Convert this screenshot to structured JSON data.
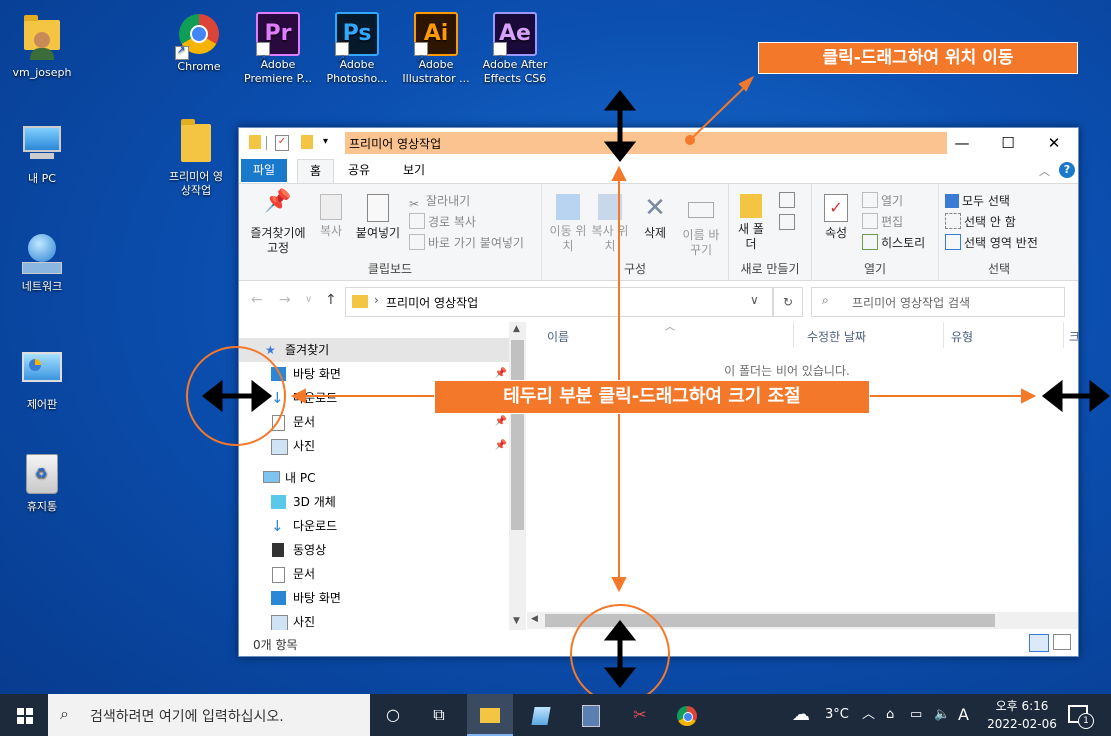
{
  "desktop": {
    "icons": [
      {
        "label": "vm_joseph"
      },
      {
        "label": "Chrome"
      },
      {
        "label": "Adobe Premiere P...",
        "abbr": "Pr"
      },
      {
        "label": "Adobe Photosho...",
        "abbr": "Ps"
      },
      {
        "label": "Adobe Illustrator ...",
        "abbr": "Ai"
      },
      {
        "label": "Adobe After Effects CS6",
        "abbr": "Ae"
      },
      {
        "label": "내 PC"
      },
      {
        "label": "프리미어 영상작업"
      },
      {
        "label": "네트워크"
      },
      {
        "label": "제어판"
      },
      {
        "label": "휴지통"
      }
    ]
  },
  "annotations": {
    "move": "클릭-드래그하여 위치 이동",
    "resize": "테두리 부분 클릭-드래그하여 크기 조절",
    "accent": "#f4782a"
  },
  "explorer": {
    "title": "프리미어 영상작업",
    "tabs": [
      "파일",
      "홈",
      "공유",
      "보기"
    ],
    "ribbon": {
      "clipboard": {
        "label": "클립보드",
        "pin": "즐겨찾기에 고정",
        "copy": "복사",
        "paste": "붙여넣기",
        "cut": "잘라내기",
        "copy_path": "경로 복사",
        "paste_shortcut": "바로 가기 붙여넣기"
      },
      "organize": {
        "label": "구성",
        "move_to": "이동 위치",
        "copy_to": "복사 위치",
        "delete": "삭제",
        "rename": "이름 바꾸기"
      },
      "new": {
        "label": "새로 만들기",
        "new_folder": "새 폴더"
      },
      "open": {
        "label": "열기",
        "properties": "속성",
        "open": "열기",
        "edit": "편집",
        "history": "히스토리"
      },
      "select": {
        "label": "선택",
        "select_all": "모두 선택",
        "select_none": "선택 안 함",
        "invert": "선택 영역 반전"
      }
    },
    "address": "프리미어 영상작업",
    "search_placeholder": "프리미어 영상작업 검색",
    "nav": {
      "favorites": "즐겨찾기",
      "fav_items": [
        "바탕 화면",
        "다운로드",
        "문서",
        "사진"
      ],
      "this_pc": "내 PC",
      "pc_items": [
        "3D 개체",
        "다운로드",
        "동영상",
        "문서",
        "바탕 화면",
        "사진"
      ]
    },
    "columns": [
      "이름",
      "수정한 날짜",
      "유형",
      "크"
    ],
    "empty_message": "이 폴더는 비어 있습니다.",
    "status": "0개 항목"
  },
  "taskbar": {
    "search_placeholder": "검색하려면 여기에 입력하십시오.",
    "weather": "3°C",
    "ime": "A",
    "time": "오후 6:16",
    "date": "2022-02-06",
    "notification_count": "1"
  }
}
